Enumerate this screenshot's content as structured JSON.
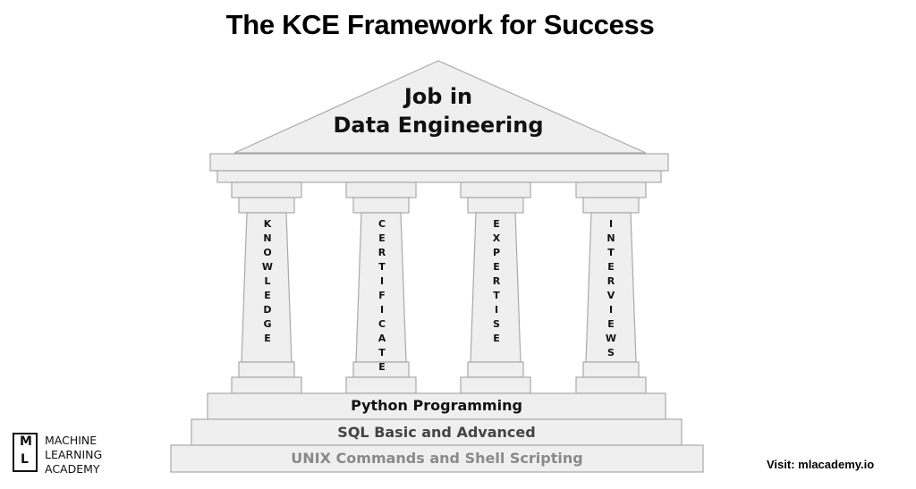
{
  "title": "The KCE Framework for Success",
  "roof": {
    "line1": "Job in",
    "line2": "Data Engineering"
  },
  "pillars": [
    {
      "label": "KNOWLEDGE"
    },
    {
      "label": "CERTIFICATE"
    },
    {
      "label": "EXPERTISE"
    },
    {
      "label": "INTERVIEWS"
    }
  ],
  "steps": [
    {
      "label": "Python Programming",
      "color": "#111111"
    },
    {
      "label": "SQL Basic and Advanced",
      "color": "#444444"
    },
    {
      "label": "UNIX Commands and Shell Scripting",
      "color": "#8a8a8a"
    }
  ],
  "logo": {
    "letter_m": "M",
    "letter_l": "L",
    "text": "MACHINE\nLEARNING\nACADEMY"
  },
  "visit": "Visit: mlacademy.io",
  "colors": {
    "fill": "#efefef",
    "stroke": "#a9a9a9"
  }
}
